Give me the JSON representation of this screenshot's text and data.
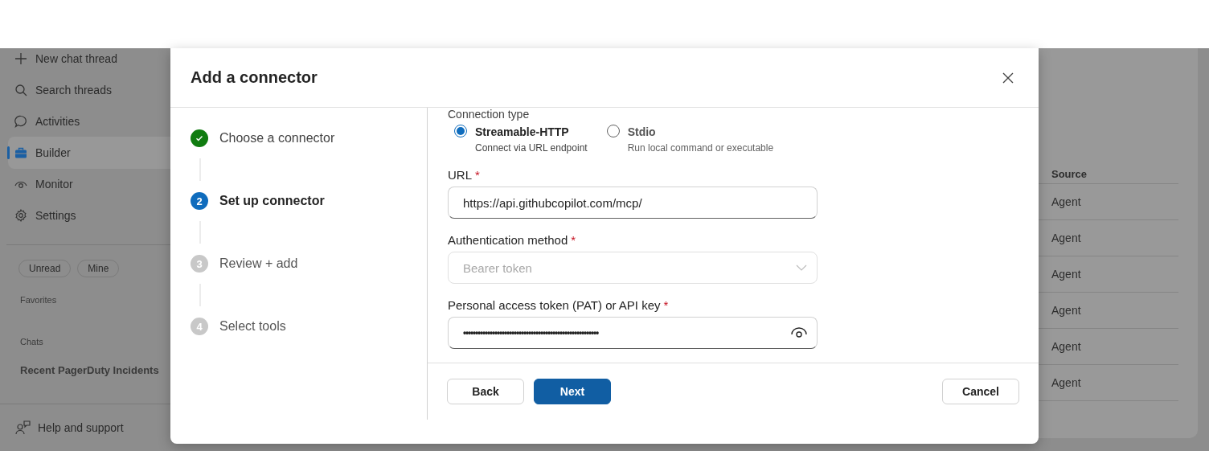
{
  "sidebar": {
    "nav_items": [
      {
        "label": "New chat thread",
        "selected": false
      },
      {
        "label": "Search threads",
        "selected": false
      },
      {
        "label": "Activities",
        "selected": false
      },
      {
        "label": "Builder",
        "selected": true
      },
      {
        "label": "Monitor",
        "selected": false
      },
      {
        "label": "Settings",
        "selected": false
      }
    ],
    "filters": [
      {
        "label": "Unread",
        "selected": false
      },
      {
        "label": "Mine",
        "selected": false
      }
    ],
    "favorites_heading": "Favorites",
    "chats_heading": "Chats",
    "chats": [
      "Recent PagerDuty Incidents"
    ],
    "help": "Help and support"
  },
  "table": {
    "columns": [
      "Source"
    ],
    "rows": [
      [
        "Agent"
      ],
      [
        "Agent"
      ],
      [
        "Agent"
      ],
      [
        "Agent"
      ],
      [
        "Agent"
      ],
      [
        "Agent"
      ]
    ]
  },
  "dialog": {
    "title": "Add a connector",
    "steps": [
      {
        "label": "Choose a connector",
        "completed": true,
        "selected": false
      },
      {
        "number": "2",
        "label": "Set up connector",
        "completed": false,
        "selected": true
      },
      {
        "number": "3",
        "label": "Review + add",
        "completed": false,
        "selected": false
      },
      {
        "number": "4",
        "label": "Select tools",
        "completed": false,
        "selected": false
      }
    ],
    "connection_type": {
      "label": "Connection type",
      "options": [
        {
          "title": "Streamable-HTTP",
          "description": "Connect via URL endpoint",
          "selected": true
        },
        {
          "title": "Stdio",
          "description": "Run local command or executable",
          "selected": false
        }
      ]
    },
    "fields": [
      {
        "kind": "text",
        "label": "URL",
        "required_mark": "*",
        "value": "https://api.githubcopilot.com/mcp/",
        "disabled": false
      },
      {
        "kind": "dropdown",
        "label": "Authentication method",
        "required_mark": "*",
        "value": "Bearer token",
        "disabled": true
      },
      {
        "kind": "secret",
        "label": "Personal access token (PAT) or API key",
        "required_mark": "*",
        "value": "••••••••••••••••••••••••••••••••••••••••••••••••••••••••",
        "disabled": false
      }
    ],
    "buttons": [
      {
        "label": "Back",
        "kind": "secondary"
      },
      {
        "label": "Next",
        "kind": "primary"
      },
      {
        "label": "Cancel",
        "kind": "cancel"
      }
    ]
  }
}
